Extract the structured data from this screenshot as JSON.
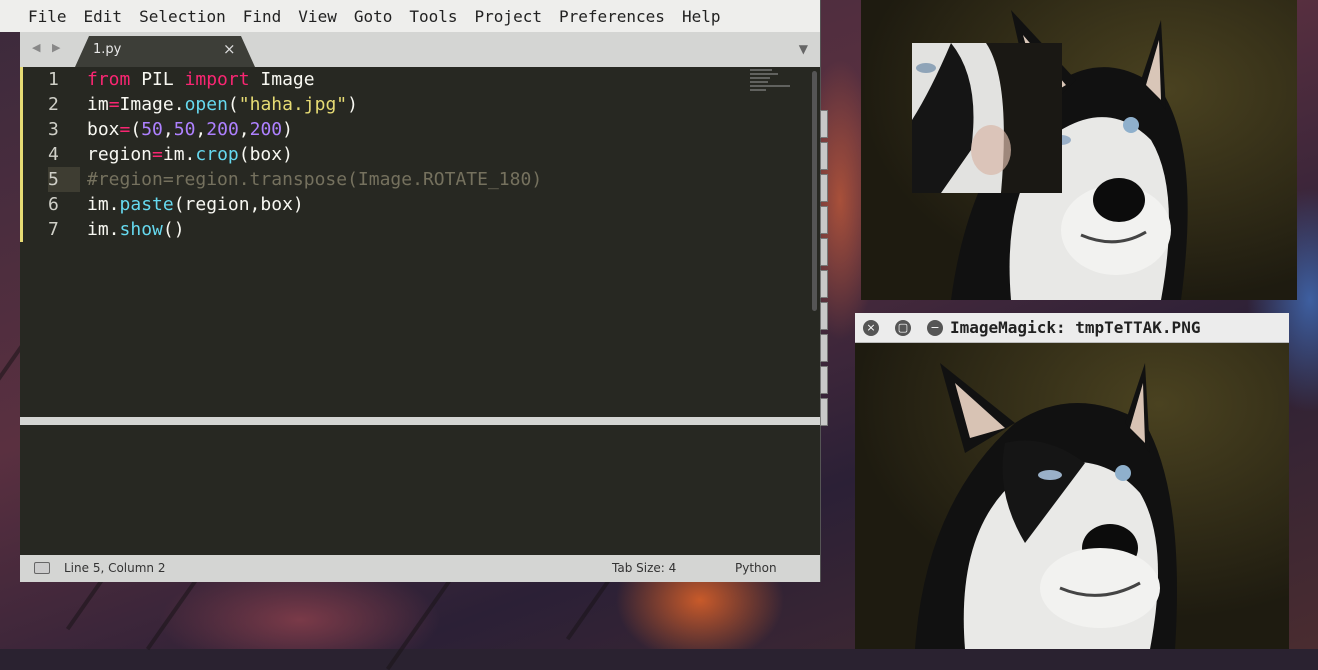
{
  "menu": [
    "File",
    "Edit",
    "Selection",
    "Find",
    "View",
    "Goto",
    "Tools",
    "Project",
    "Preferences",
    "Help"
  ],
  "tab": {
    "filename": "1.py",
    "close": "×",
    "arrows": "◀ ▶",
    "menu": "▼"
  },
  "code": {
    "line_numbers": [
      "1",
      "2",
      "3",
      "4",
      "5",
      "6",
      "7"
    ],
    "current_line": 5
  },
  "status": {
    "position": "Line 5, Column 2",
    "tab_size": "Tab Size: 4",
    "syntax": "Python"
  },
  "imagemagick": {
    "title": "ImageMagick: tmpTeTTAK.PNG",
    "buttons": {
      "close": "×",
      "maximize": "▢",
      "minimize": "−"
    }
  },
  "colors": {
    "editor_bg": "#272822",
    "keyword": "#f92672",
    "function": "#66d9ef",
    "string": "#e6db74",
    "number": "#ae81ff",
    "comment": "#75715e"
  }
}
